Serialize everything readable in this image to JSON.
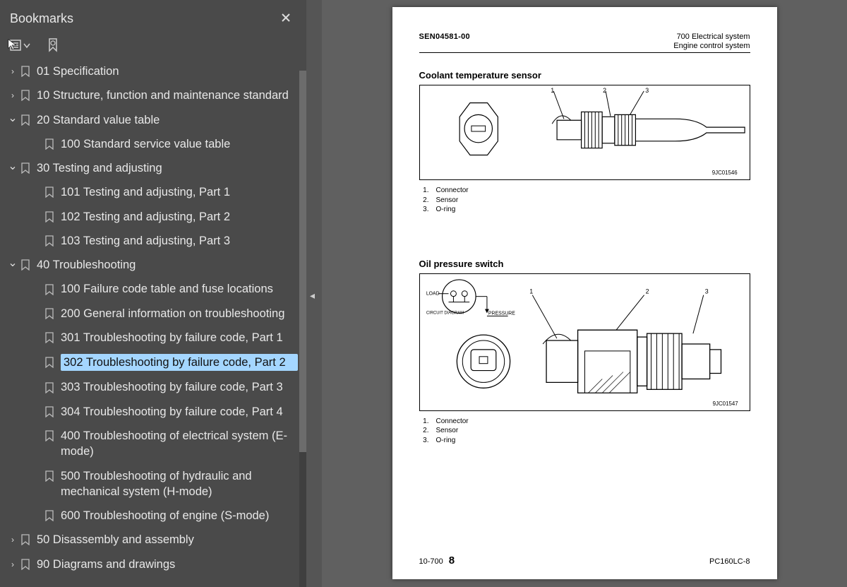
{
  "sidebar": {
    "title": "Bookmarks",
    "items": [
      {
        "chevron": "›",
        "indent": 0,
        "label": "01 Specification"
      },
      {
        "chevron": "›",
        "indent": 0,
        "label": "10 Structure, function and maintenance standard"
      },
      {
        "chevron": "⌄",
        "indent": 0,
        "label": "20 Standard value table"
      },
      {
        "chevron": "",
        "indent": 1,
        "label": "100 Standard service value table"
      },
      {
        "chevron": "⌄",
        "indent": 0,
        "label": "30 Testing and adjusting"
      },
      {
        "chevron": "",
        "indent": 1,
        "label": "101 Testing and adjusting, Part 1"
      },
      {
        "chevron": "",
        "indent": 1,
        "label": "102 Testing and adjusting, Part 2"
      },
      {
        "chevron": "",
        "indent": 1,
        "label": "103 Testing and adjusting, Part 3"
      },
      {
        "chevron": "⌄",
        "indent": 0,
        "label": "40 Troubleshooting"
      },
      {
        "chevron": "",
        "indent": 1,
        "label": "100 Failure code table and fuse locations"
      },
      {
        "chevron": "",
        "indent": 1,
        "label": "200 General information on troubleshooting"
      },
      {
        "chevron": "",
        "indent": 1,
        "label": "301 Troubleshooting by failure code, Part 1"
      },
      {
        "chevron": "",
        "indent": 1,
        "label": "302 Troubleshooting by failure code, Part 2",
        "selected": true
      },
      {
        "chevron": "",
        "indent": 1,
        "label": "303 Troubleshooting by failure code, Part 3"
      },
      {
        "chevron": "",
        "indent": 1,
        "label": "304 Troubleshooting by failure code, Part 4"
      },
      {
        "chevron": "",
        "indent": 1,
        "label": "400 Troubleshooting of electrical system (E-mode)",
        "multi": true
      },
      {
        "chevron": "",
        "indent": 1,
        "label": "500 Troubleshooting of hydraulic and mechanical system (H-mode)",
        "multi": true
      },
      {
        "chevron": "",
        "indent": 1,
        "label": "600 Troubleshooting of engine (S-mode)"
      },
      {
        "chevron": "›",
        "indent": 0,
        "label": "50 Disassembly and assembly"
      },
      {
        "chevron": "›",
        "indent": 0,
        "label": "90 Diagrams and drawings"
      }
    ]
  },
  "doc": {
    "header_left": "SEN04581-00",
    "header_right1": "700 Electrical system",
    "header_right2": "Engine control system",
    "section1_title": "Coolant temperature sensor",
    "ref1": "9JC01546",
    "section2_title": "Oil pressure switch",
    "ref2": "9JC01547",
    "legend": [
      {
        "n": "1.",
        "t": "Connector"
      },
      {
        "n": "2.",
        "t": "Sensor"
      },
      {
        "n": "3.",
        "t": "O-ring"
      }
    ],
    "diag2_labels": {
      "load": "LOAD",
      "circuit": "CIRCUIT\nDIAGRAM",
      "pressure": "PRESSURE"
    },
    "footer_left_prefix": "10-700",
    "footer_page": "8",
    "footer_right": "PC160LC-8"
  }
}
